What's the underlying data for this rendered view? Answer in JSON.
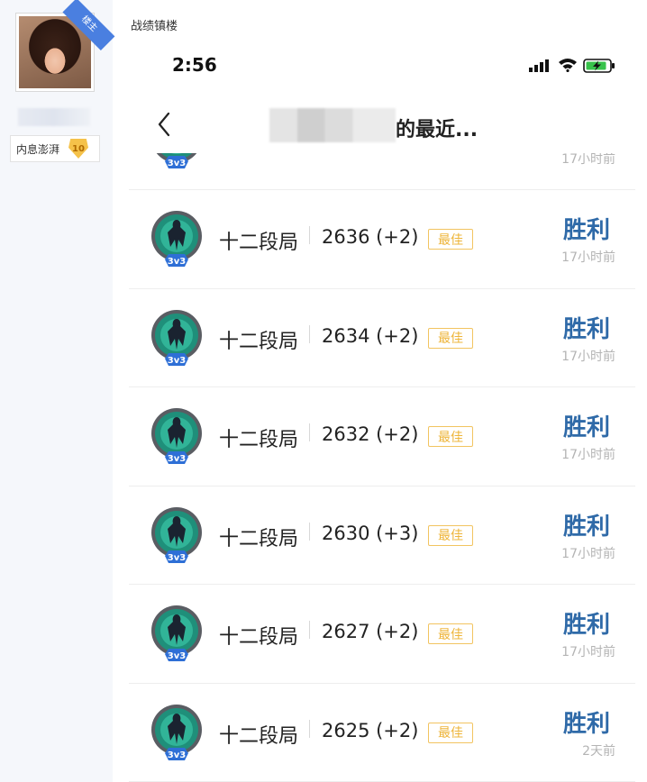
{
  "sidebar": {
    "ribbon": "楼主",
    "level_name": "内息澎湃",
    "level_num": "10"
  },
  "post": {
    "title": "战绩镇楼"
  },
  "phone": {
    "time": "2:56",
    "nav_title_visible": "的最近...",
    "matches": [
      {
        "mode": "3v3",
        "time_ago": "17小时前"
      },
      {
        "mode": "3v3",
        "rank": "十二段局",
        "score": "2636  (+2)",
        "tag": "最佳",
        "result": "胜利",
        "time_ago": "17小时前"
      },
      {
        "mode": "3v3",
        "rank": "十二段局",
        "score": "2634  (+2)",
        "tag": "最佳",
        "result": "胜利",
        "time_ago": "17小时前"
      },
      {
        "mode": "3v3",
        "rank": "十二段局",
        "score": "2632  (+2)",
        "tag": "最佳",
        "result": "胜利",
        "time_ago": "17小时前"
      },
      {
        "mode": "3v3",
        "rank": "十二段局",
        "score": "2630  (+3)",
        "tag": "最佳",
        "result": "胜利",
        "time_ago": "17小时前"
      },
      {
        "mode": "3v3",
        "rank": "十二段局",
        "score": "2627  (+2)",
        "tag": "最佳",
        "result": "胜利",
        "time_ago": "17小时前"
      },
      {
        "mode": "3v3",
        "rank": "十二段局",
        "score": "2625  (+2)",
        "tag": "最佳",
        "result": "胜利",
        "time_ago": "2天前"
      }
    ]
  }
}
